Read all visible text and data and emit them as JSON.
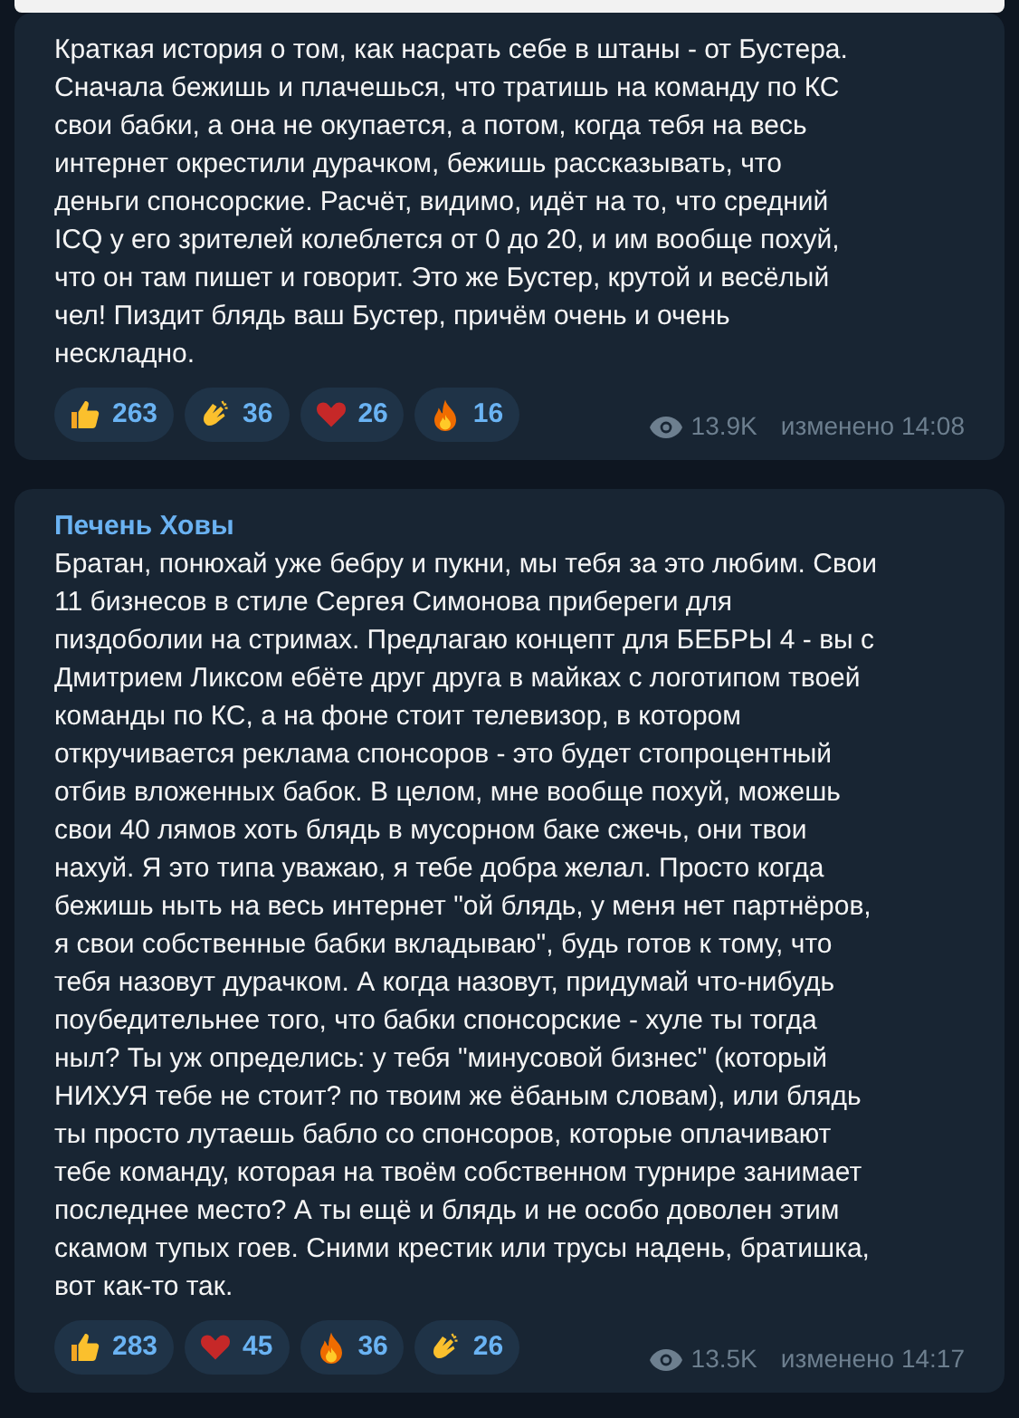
{
  "messages": [
    {
      "text": "Краткая история о том, как насрать себе в штаны - от Бустера.\nСначала бежишь и плачешься, что тратишь на команду по КС\nсвои бабки, а она не окупается, а потом, когда тебя на весь\nинтернет окрестили дурачком, бежишь рассказывать, что\nденьги спонсорские. Расчёт, видимо, идёт на то, что средний\nICQ у его зрителей колеблется от 0 до 20, и им вообще похуй,\nчто он там пишет и говорит. Это же Бустер, крутой и весёлый\nчел! Пиздит блядь ваш Бустер, причём очень и очень\nнескладно.",
      "reactions": [
        {
          "kind": "thumbs_up",
          "count": "263"
        },
        {
          "kind": "clap",
          "count": "36"
        },
        {
          "kind": "heart",
          "count": "26"
        },
        {
          "kind": "fire",
          "count": "16"
        }
      ],
      "views": "13.9K",
      "edited": "изменено 14:08"
    },
    {
      "author": "Печень Ховы",
      "text": "Братан, понюхай уже бебру и пукни, мы тебя за это любим. Свои\n11 бизнесов в стиле Сергея Симонова прибереги для\nпиздоболии на стримах. Предлагаю концепт для БЕБРЫ 4 - вы с\nДмитрием Ликсом ебёте друг друга в майках с логотипом твоей\nкоманды по КС, а на фоне стоит телевизор, в котором\nоткручивается реклама спонсоров - это будет стопроцентный\nотбив вложенных бабок. В целом, мне вообще похуй, можешь\nсвои 40 лямов хоть блядь в мусорном баке сжечь, они твои\nнахуй. Я это типа уважаю, я тебе добра желал. Просто когда\nбежишь ныть на весь интернет \"ой блядь, у меня нет партнёров,\nя свои собственные бабки вкладываю\", будь готов к тому, что\nтебя назовут дурачком. А когда назовут, придумай что-нибудь\nпоубедительнее того, что бабки спонсорские - хуле ты тогда\nныл? Ты уж определись: у тебя \"минусовой бизнес\" (который\nНИХУЯ тебе не стоит? по твоим же ёбаным словам), или блядь\nты просто лутаешь бабло со спонсоров, которые оплачивают\nтебе команду, которая на твоём собственном турнире занимает\nпоследнее место? А ты ещё и блядь и не особо доволен этим\nскамом тупых гоев. Сними крестик или трусы надень, братишка,\nвот как-то так.",
      "reactions": [
        {
          "kind": "thumbs_up",
          "count": "283"
        },
        {
          "kind": "heart",
          "count": "45"
        },
        {
          "kind": "fire",
          "count": "36"
        },
        {
          "kind": "clap",
          "count": "26"
        }
      ],
      "views": "13.5K",
      "edited": "изменено 14:17"
    }
  ]
}
